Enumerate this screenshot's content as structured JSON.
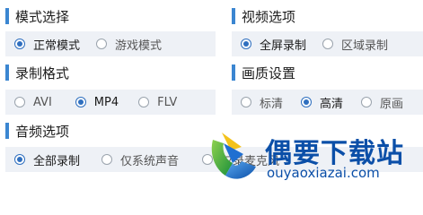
{
  "mode": {
    "title": "模式选择",
    "options": [
      {
        "label": "正常模式",
        "selected": true
      },
      {
        "label": "游戏模式",
        "selected": false
      }
    ]
  },
  "video": {
    "title": "视频选项",
    "options": [
      {
        "label": "全屏录制",
        "selected": true
      },
      {
        "label": "区域录制",
        "selected": false
      }
    ]
  },
  "format": {
    "title": "录制格式",
    "options": [
      {
        "label": "AVI",
        "selected": false
      },
      {
        "label": "MP4",
        "selected": true
      },
      {
        "label": "FLV",
        "selected": false
      }
    ]
  },
  "quality": {
    "title": "画质设置",
    "options": [
      {
        "label": "标清",
        "selected": false
      },
      {
        "label": "高清",
        "selected": true
      },
      {
        "label": "原画",
        "selected": false
      }
    ]
  },
  "audio": {
    "title": "音频选项",
    "options": [
      {
        "label": "全部录制",
        "selected": true
      },
      {
        "label": "仅系统声音",
        "selected": false
      },
      {
        "label": "仅录麦克风",
        "selected": false
      }
    ]
  },
  "watermark": {
    "brand": "偶要下载站",
    "url": "ouyaoxiazai.com"
  },
  "colors": {
    "accent": "#3b86d1",
    "row_bg": "#eef1f6",
    "watermark": "#0b4fa8"
  }
}
